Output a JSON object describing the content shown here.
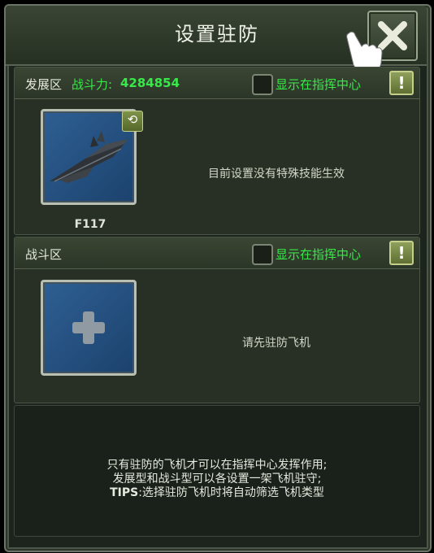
{
  "header": {
    "title": "设置驻防"
  },
  "sections": [
    {
      "label": "发展区",
      "power_label": "战斗力:",
      "power_value": "4284854",
      "show_label": "显示在指挥中心",
      "plane_name": "F117",
      "status_text": "目前设置没有特殊技能生效"
    },
    {
      "label": "战斗区",
      "show_label": "显示在指挥中心",
      "status_text": "请先驻防飞机"
    }
  ],
  "tips": {
    "line1": "只有驻防的飞机才可以在指挥中心发挥作用;",
    "line2": "发展型和战斗型可以各设置一架飞机驻守;",
    "line3_label": "TIPS",
    "line3_text": ":选择驻防飞机时将自动筛选飞机类型"
  },
  "colors": {
    "accent_green": "#39e84a",
    "slot_blue": "#2e5f93"
  },
  "icons": {
    "close": "close-icon",
    "warn": "exclamation-icon",
    "swap": "swap-icon",
    "add": "plus-icon",
    "pointer": "pointing-hand-icon"
  }
}
